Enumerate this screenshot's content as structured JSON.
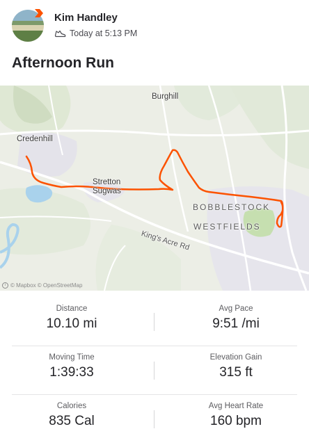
{
  "activity": {
    "athlete_name": "Kim Handley",
    "timestamp": "Today at 5:13 PM",
    "activity_icon": "shoe-icon",
    "title": "Afternoon Run"
  },
  "map": {
    "labels": {
      "burghill": "Burghill",
      "credenhill": "Credenhill",
      "stretton_line1": "Stretton",
      "stretton_line2": "Sugwas",
      "bobblestock": "BOBBLESTOCK",
      "westfields": "WESTFIELDS",
      "road": "King's Acre Rd"
    },
    "attribution": "© Mapbox © OpenStreetMap",
    "route_color": "#fc5200"
  },
  "stats": [
    {
      "left": {
        "label": "Distance",
        "value": "10.10 mi"
      },
      "right": {
        "label": "Avg Pace",
        "value": "9:51 /mi"
      }
    },
    {
      "left": {
        "label": "Moving Time",
        "value": "1:39:33"
      },
      "right": {
        "label": "Elevation Gain",
        "value": "315 ft"
      }
    },
    {
      "left": {
        "label": "Calories",
        "value": "835 Cal"
      },
      "right": {
        "label": "Avg Heart Rate",
        "value": "160 bpm"
      }
    }
  ],
  "colors": {
    "brand": "#fc5200",
    "text": "#242428",
    "muted": "#5c5c60"
  }
}
